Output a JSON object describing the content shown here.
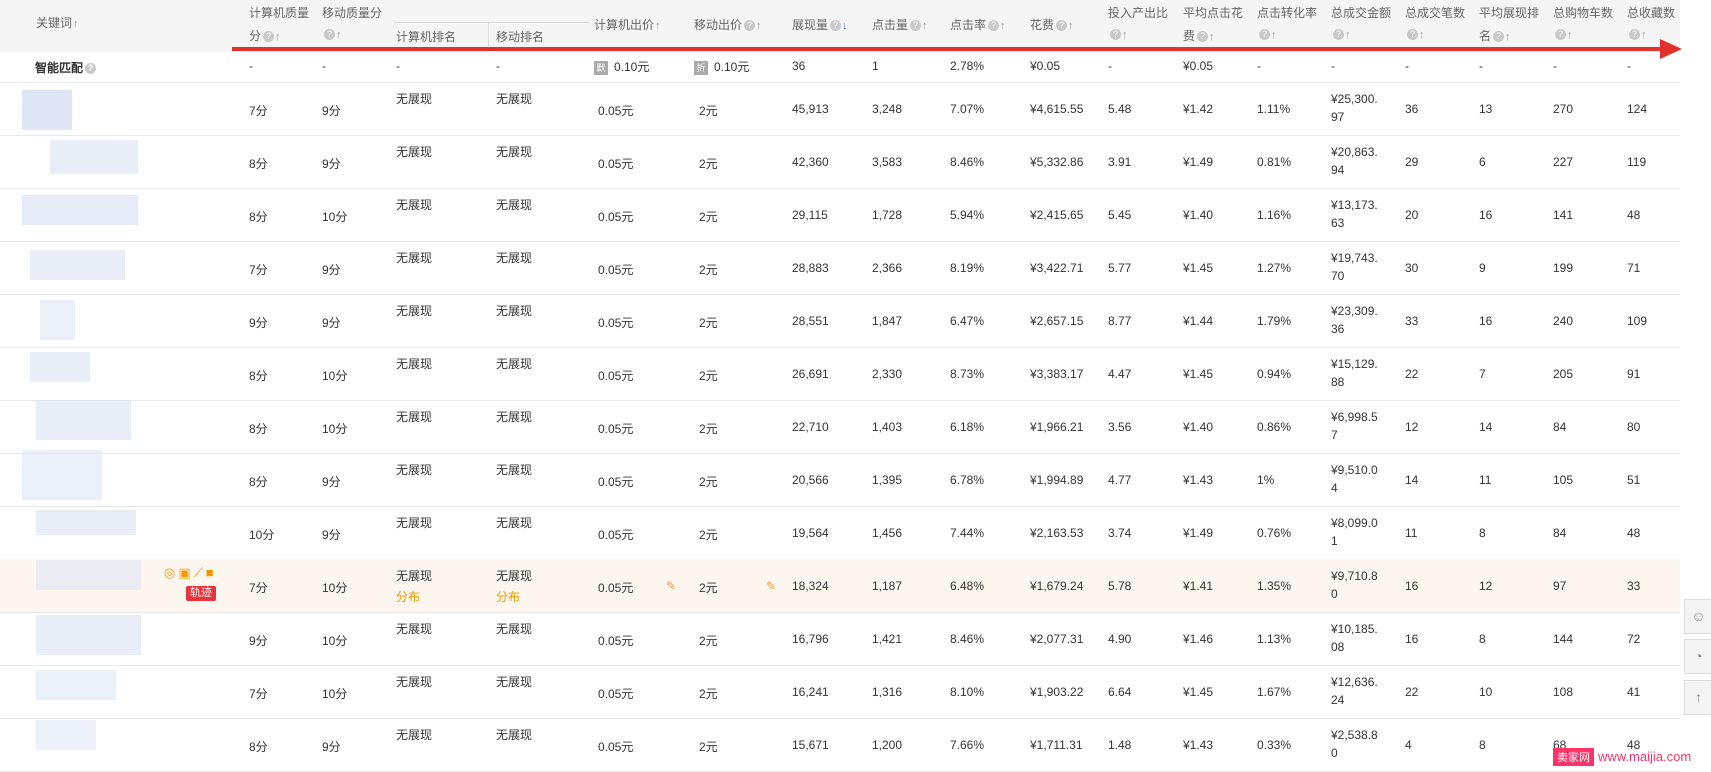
{
  "headers": {
    "keyword": "关键词",
    "pc_quality_line1": "计算机质量",
    "pc_quality_line2": "分",
    "mobile_quality": "移动质量分",
    "pc_rank": "计算机排名",
    "mobile_rank": "移动排名",
    "pc_bid": "计算机出价",
    "mobile_bid": "移动出价",
    "impressions": "展现量",
    "clicks": "点击量",
    "ctr": "点击率",
    "cost": "花费",
    "roi_line1": "投入产出比",
    "cpc_line1": "平均点击花",
    "cpc_line2": "费",
    "cvr": "点击转化率",
    "gmv": "总成交金额",
    "orders": "总成交笔数",
    "avg_rank_line1": "平均展现排",
    "avg_rank_line2": "名",
    "cart": "总购物车数",
    "fav": "总收藏数"
  },
  "smart_row": {
    "keyword": "智能匹配",
    "pc_quality": "-",
    "mobile_quality": "-",
    "pc_rank": "-",
    "mobile_rank": "-",
    "pc_bid_tag": "默",
    "pc_bid": "0.10元",
    "mobile_bid_tag": "折",
    "mobile_bid": "0.10元",
    "impressions": "36",
    "clicks": "1",
    "ctr": "2.78%",
    "cost": "¥0.05",
    "roi": "-",
    "cpc": "¥0.05",
    "cvr": "-",
    "gmv": "-",
    "orders": "-",
    "avg_rank": "-",
    "cart": "-",
    "fav": "-"
  },
  "rows": [
    {
      "pcq": "7分",
      "mq": "9分",
      "pcr": "无展现",
      "mr": "无展现",
      "pcb": "0.05元",
      "mb": "2元",
      "imp": "45,913",
      "clk": "3,248",
      "ctr": "7.07%",
      "cost": "¥4,615.55",
      "roi": "5.48",
      "cpc": "¥1.42",
      "cvr": "1.11%",
      "gmv1": "¥25,300.",
      "gmv2": "97",
      "ord": "36",
      "ar": "13",
      "cart": "270",
      "fav": "124"
    },
    {
      "pcq": "8分",
      "mq": "9分",
      "pcr": "无展现",
      "mr": "无展现",
      "pcb": "0.05元",
      "mb": "2元",
      "imp": "42,360",
      "clk": "3,583",
      "ctr": "8.46%",
      "cost": "¥5,332.86",
      "roi": "3.91",
      "cpc": "¥1.49",
      "cvr": "0.81%",
      "gmv1": "¥20,863.",
      "gmv2": "94",
      "ord": "29",
      "ar": "6",
      "cart": "227",
      "fav": "119"
    },
    {
      "pcq": "8分",
      "mq": "10分",
      "pcr": "无展现",
      "mr": "无展现",
      "pcb": "0.05元",
      "mb": "2元",
      "imp": "29,115",
      "clk": "1,728",
      "ctr": "5.94%",
      "cost": "¥2,415.65",
      "roi": "5.45",
      "cpc": "¥1.40",
      "cvr": "1.16%",
      "gmv1": "¥13,173.",
      "gmv2": "63",
      "ord": "20",
      "ar": "16",
      "cart": "141",
      "fav": "48"
    },
    {
      "pcq": "7分",
      "mq": "9分",
      "pcr": "无展现",
      "mr": "无展现",
      "pcb": "0.05元",
      "mb": "2元",
      "imp": "28,883",
      "clk": "2,366",
      "ctr": "8.19%",
      "cost": "¥3,422.71",
      "roi": "5.77",
      "cpc": "¥1.45",
      "cvr": "1.27%",
      "gmv1": "¥19,743.",
      "gmv2": "70",
      "ord": "30",
      "ar": "9",
      "cart": "199",
      "fav": "71"
    },
    {
      "pcq": "9分",
      "mq": "9分",
      "pcr": "无展现",
      "mr": "无展现",
      "pcb": "0.05元",
      "mb": "2元",
      "imp": "28,551",
      "clk": "1,847",
      "ctr": "6.47%",
      "cost": "¥2,657.15",
      "roi": "8.77",
      "cpc": "¥1.44",
      "cvr": "1.79%",
      "gmv1": "¥23,309.",
      "gmv2": "36",
      "ord": "33",
      "ar": "16",
      "cart": "240",
      "fav": "109"
    },
    {
      "pcq": "8分",
      "mq": "10分",
      "pcr": "无展现",
      "mr": "无展现",
      "pcb": "0.05元",
      "mb": "2元",
      "imp": "26,691",
      "clk": "2,330",
      "ctr": "8.73%",
      "cost": "¥3,383.17",
      "roi": "4.47",
      "cpc": "¥1.45",
      "cvr": "0.94%",
      "gmv1": "¥15,129.",
      "gmv2": "88",
      "ord": "22",
      "ar": "7",
      "cart": "205",
      "fav": "91"
    },
    {
      "pcq": "8分",
      "mq": "10分",
      "pcr": "无展现",
      "mr": "无展现",
      "pcb": "0.05元",
      "mb": "2元",
      "imp": "22,710",
      "clk": "1,403",
      "ctr": "6.18%",
      "cost": "¥1,966.21",
      "roi": "3.56",
      "cpc": "¥1.40",
      "cvr": "0.86%",
      "gmv1": "¥6,998.5",
      "gmv2": "7",
      "ord": "12",
      "ar": "14",
      "cart": "84",
      "fav": "80"
    },
    {
      "pcq": "8分",
      "mq": "9分",
      "pcr": "无展现",
      "mr": "无展现",
      "pcb": "0.05元",
      "mb": "2元",
      "imp": "20,566",
      "clk": "1,395",
      "ctr": "6.78%",
      "cost": "¥1,994.89",
      "roi": "4.77",
      "cpc": "¥1.43",
      "cvr": "1%",
      "gmv1": "¥9,510.0",
      "gmv2": "4",
      "ord": "14",
      "ar": "11",
      "cart": "105",
      "fav": "51"
    },
    {
      "pcq": "10分",
      "mq": "9分",
      "pcr": "无展现",
      "mr": "无展现",
      "pcb": "0.05元",
      "mb": "2元",
      "imp": "19,564",
      "clk": "1,456",
      "ctr": "7.44%",
      "cost": "¥2,163.53",
      "roi": "3.74",
      "cpc": "¥1.49",
      "cvr": "0.76%",
      "gmv1": "¥8,099.0",
      "gmv2": "1",
      "ord": "11",
      "ar": "8",
      "cart": "84",
      "fav": "48"
    },
    {
      "pcq": "7分",
      "mq": "10分",
      "pcr": "无展现",
      "pcr2": "分布",
      "mr": "无展现",
      "mr2": "分布",
      "pcb": "0.05元",
      "mb": "2元",
      "imp": "18,324",
      "clk": "1,187",
      "ctr": "6.48%",
      "cost": "¥1,679.24",
      "roi": "5.78",
      "cpc": "¥1.41",
      "cvr": "1.35%",
      "gmv1": "¥9,710.8",
      "gmv2": "0",
      "ord": "16",
      "ar": "12",
      "cart": "97",
      "fav": "33",
      "highlight": true,
      "track": "轨迹"
    },
    {
      "pcq": "9分",
      "mq": "10分",
      "pcr": "无展现",
      "mr": "无展现",
      "pcb": "0.05元",
      "mb": "2元",
      "imp": "16,796",
      "clk": "1,421",
      "ctr": "8.46%",
      "cost": "¥2,077.31",
      "roi": "4.90",
      "cpc": "¥1.46",
      "cvr": "1.13%",
      "gmv1": "¥10,185.",
      "gmv2": "08",
      "ord": "16",
      "ar": "8",
      "cart": "144",
      "fav": "72"
    },
    {
      "pcq": "7分",
      "mq": "10分",
      "pcr": "无展现",
      "mr": "无展现",
      "pcb": "0.05元",
      "mb": "2元",
      "imp": "16,241",
      "clk": "1,316",
      "ctr": "8.10%",
      "cost": "¥1,903.22",
      "roi": "6.64",
      "cpc": "¥1.45",
      "cvr": "1.67%",
      "gmv1": "¥12,636.",
      "gmv2": "24",
      "ord": "22",
      "ar": "10",
      "cart": "108",
      "fav": "41"
    },
    {
      "pcq": "8分",
      "mq": "9分",
      "pcr": "无展现",
      "mr": "无展现",
      "pcb": "0.05元",
      "mb": "2元",
      "imp": "15,671",
      "clk": "1,200",
      "ctr": "7.66%",
      "cost": "¥1,711.31",
      "roi": "1.48",
      "cpc": "¥1.43",
      "cvr": "0.33%",
      "gmv1": "¥2,538.8",
      "gmv2": "0",
      "ord": "4",
      "ar": "8",
      "cart": "68",
      "fav": "48"
    }
  ],
  "icons": {
    "question": "?",
    "sort_up": "↑",
    "sort_down_active": "↓",
    "pencil": "✎"
  },
  "watermark": {
    "logo": "卖家网",
    "url": "www.maijia.com"
  },
  "colors": {
    "arrow": "#e3312c",
    "accent_orange": "#f39800",
    "track_red": "#e8343a",
    "sort_active": "#1a73e8"
  }
}
